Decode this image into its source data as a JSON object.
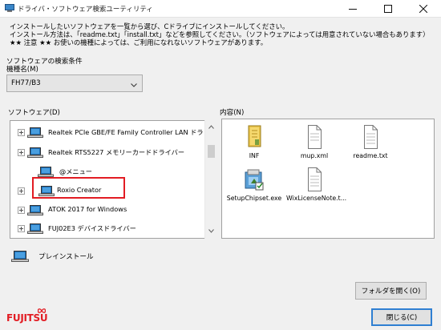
{
  "window": {
    "title": "ドライバ・ソフトウェア検索ユーティリティ",
    "buttons": {
      "minimize": "minimize",
      "maximize": "maximize",
      "close": "close"
    }
  },
  "instructions": [
    "インストールしたいソフトウェアを一覧から選び、Cドライブにインストールしてください。",
    "インストール方法は、「readme.txt」「install.txt」などを参照してください。（ソフトウェアによっては用意されていない場合もあります）",
    "★★ 注意 ★★ お使いの機種によっては、ご利用になれないソフトウェアがあります。"
  ],
  "search": {
    "section_label": "ソフトウェアの検索条件",
    "model_label": "機種名(M)",
    "model_value": "FH77/B3"
  },
  "software": {
    "label": "ソフトウェア(D)",
    "items": [
      {
        "label": "Realtek PCIe GBE/FE Family Controller LAN ドラ",
        "expander": true
      },
      {
        "label": "Realtek RTS5227 メモリーカードドライバー",
        "expander": true
      },
      {
        "label": "@メニュー",
        "expander": false
      },
      {
        "label": "Roxio Creator",
        "expander": true
      },
      {
        "label": "ATOK 2017 for Windows",
        "expander": true
      },
      {
        "label": "FUJ02E3 デバイスドライバー",
        "expander": true
      },
      {
        "label": "",
        "expander": true
      }
    ]
  },
  "contents": {
    "label": "内容(N)",
    "files": [
      {
        "name": "INF",
        "icon": "folder-icon"
      },
      {
        "name": "mup.xml",
        "icon": "document-icon"
      },
      {
        "name": "readme.txt",
        "icon": "document-icon"
      },
      {
        "name": "SetupChipset.exe",
        "icon": "installer-icon"
      },
      {
        "name": "WixLicenseNote.t...",
        "icon": "document-icon"
      }
    ]
  },
  "legend": {
    "preinstall_label": "プレインストール"
  },
  "actions": {
    "open_folder": "フォルダを開く(O)",
    "close": "閉じる(C)"
  },
  "brand": {
    "logo_text": "FUJITSU"
  },
  "colors": {
    "highlight": "#e21c23",
    "brand": "#e21c23",
    "focus": "#2f7fd2"
  }
}
